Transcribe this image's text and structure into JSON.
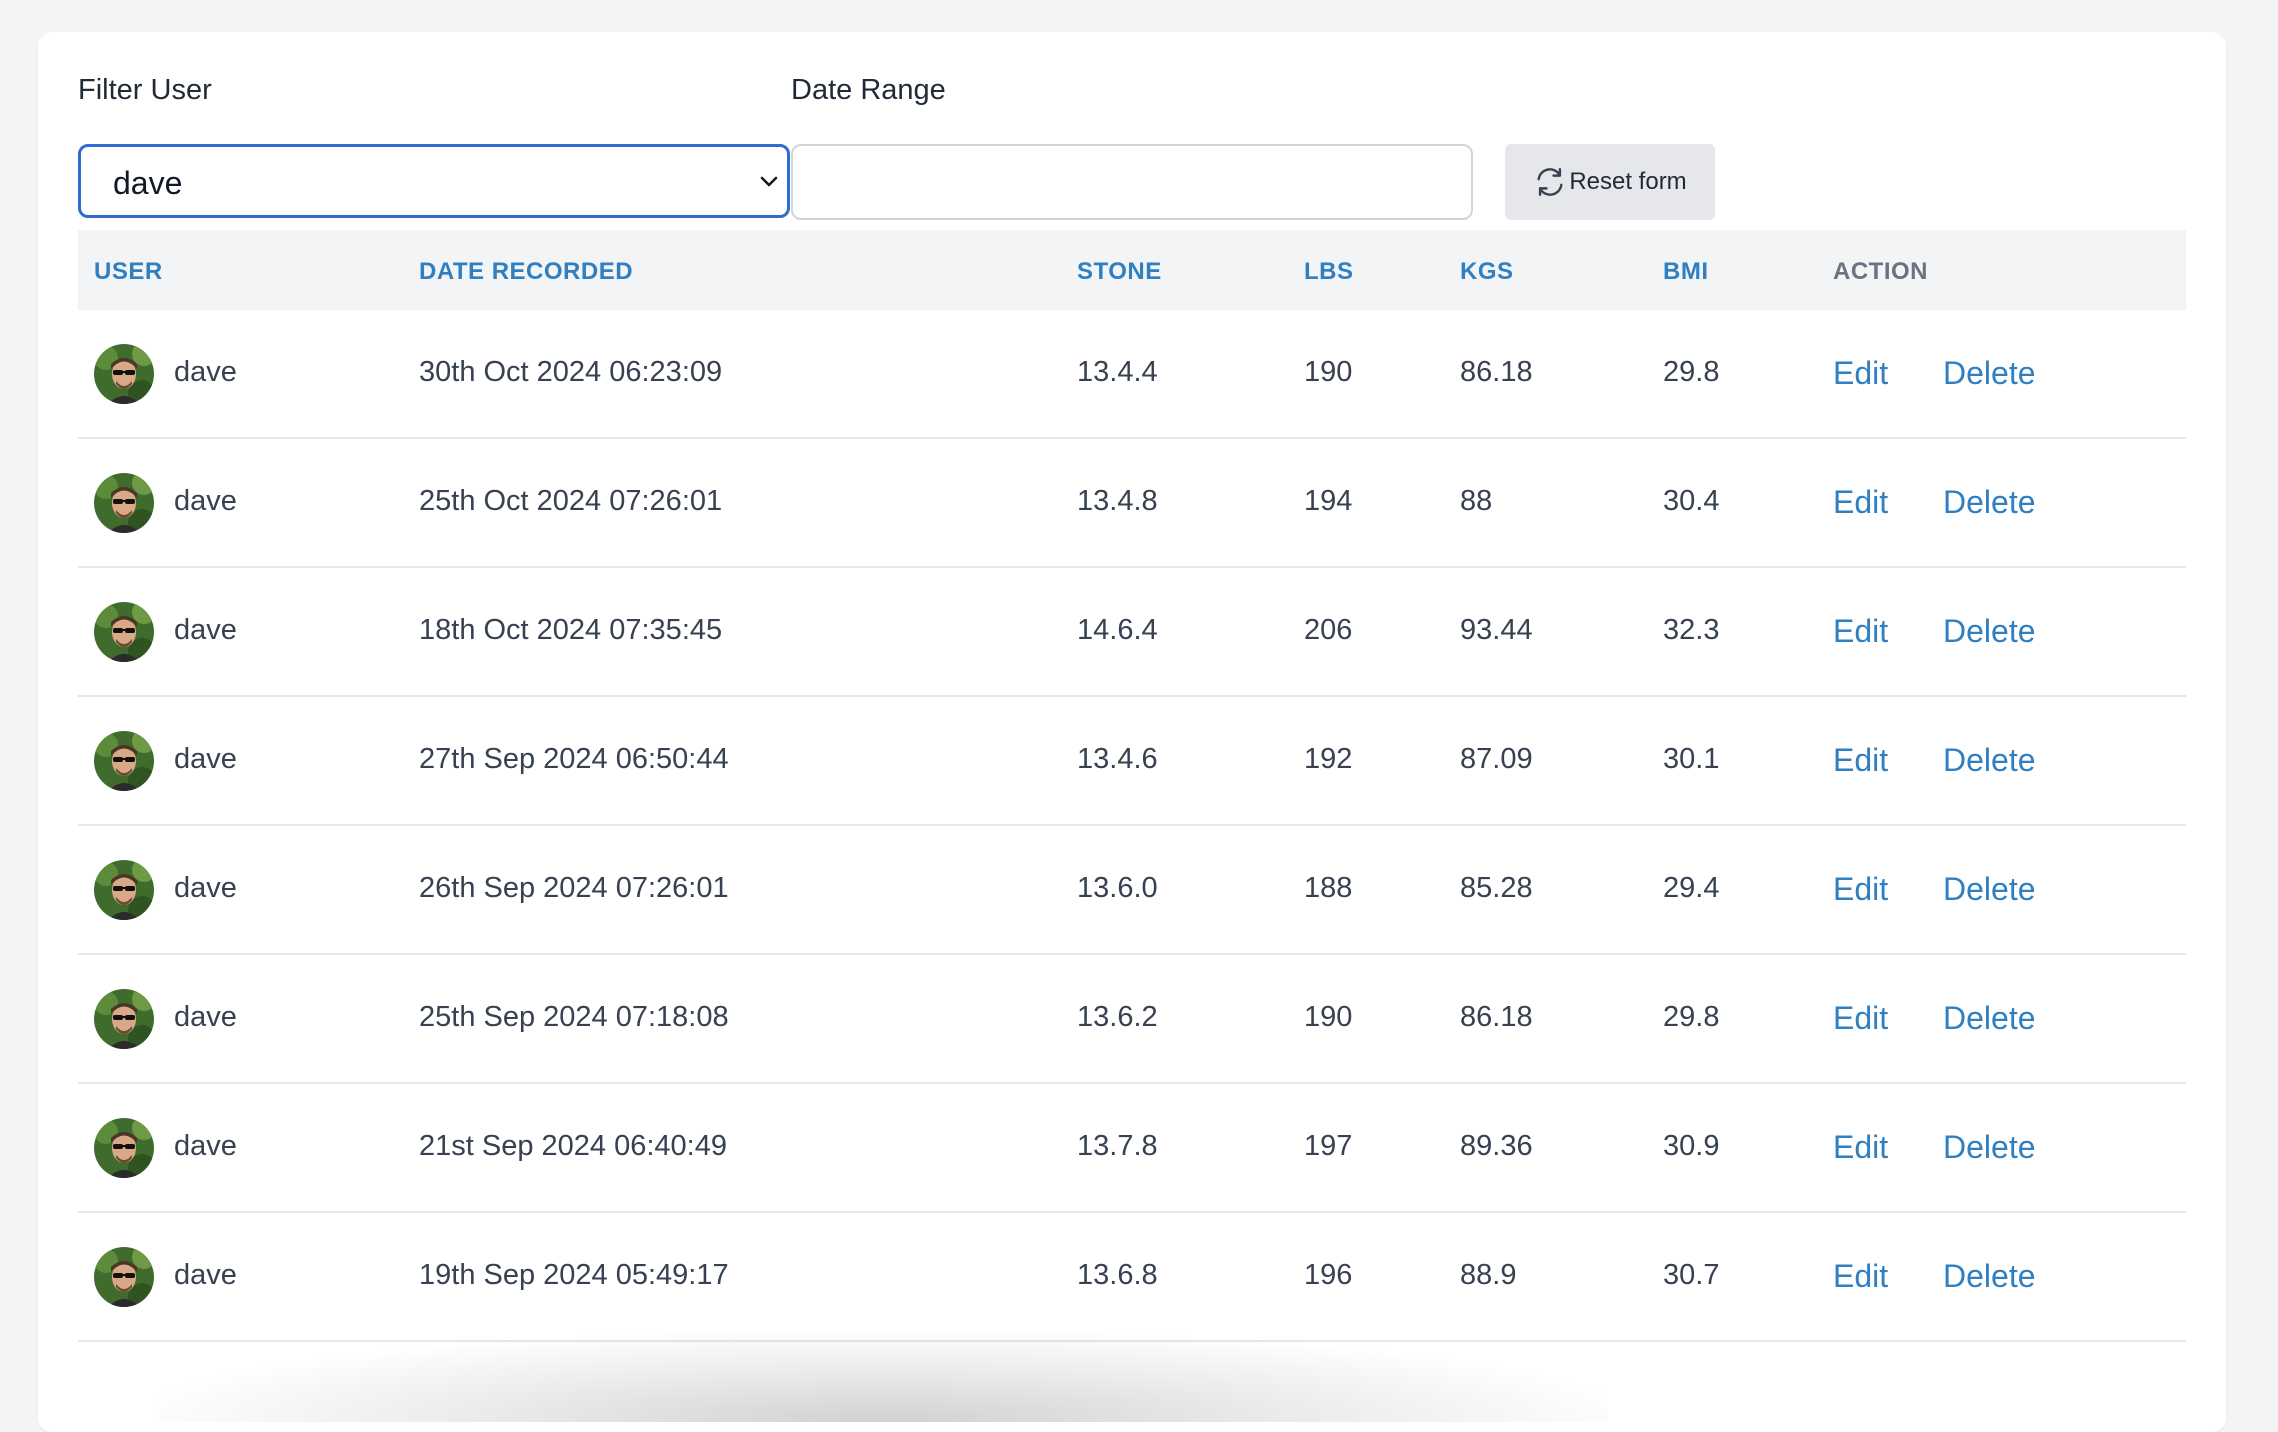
{
  "filters": {
    "user_label": "Filter User",
    "user_value": "dave",
    "date_label": "Date Range",
    "date_value": "",
    "reset_label": "Reset form"
  },
  "table": {
    "headers": {
      "user": "USER",
      "date": "DATE RECORDED",
      "stone": "STONE",
      "lbs": "LBS",
      "kgs": "KGS",
      "bmi": "BMI",
      "action": "ACTION"
    },
    "edit_label": "Edit",
    "delete_label": "Delete",
    "rows": [
      {
        "user": "dave",
        "date": "30th Oct 2024 06:23:09",
        "stone": "13.4.4",
        "lbs": "190",
        "kgs": "86.18",
        "bmi": "29.8"
      },
      {
        "user": "dave",
        "date": "25th Oct 2024 07:26:01",
        "stone": "13.4.8",
        "lbs": "194",
        "kgs": "88",
        "bmi": "30.4"
      },
      {
        "user": "dave",
        "date": "18th Oct 2024 07:35:45",
        "stone": "14.6.4",
        "lbs": "206",
        "kgs": "93.44",
        "bmi": "32.3"
      },
      {
        "user": "dave",
        "date": "27th Sep 2024 06:50:44",
        "stone": "13.4.6",
        "lbs": "192",
        "kgs": "87.09",
        "bmi": "30.1"
      },
      {
        "user": "dave",
        "date": "26th Sep 2024 07:26:01",
        "stone": "13.6.0",
        "lbs": "188",
        "kgs": "85.28",
        "bmi": "29.4"
      },
      {
        "user": "dave",
        "date": "25th Sep 2024 07:18:08",
        "stone": "13.6.2",
        "lbs": "190",
        "kgs": "86.18",
        "bmi": "29.8"
      },
      {
        "user": "dave",
        "date": "21st Sep 2024 06:40:49",
        "stone": "13.7.8",
        "lbs": "197",
        "kgs": "89.36",
        "bmi": "30.9"
      },
      {
        "user": "dave",
        "date": "19th Sep 2024 05:49:17",
        "stone": "13.6.8",
        "lbs": "196",
        "kgs": "88.9",
        "bmi": "30.7"
      }
    ]
  },
  "colors": {
    "accent": "#2f7fc1",
    "focus_border": "#2f6ccf",
    "header_bg": "#f3f4f6",
    "page_bg": "#f3f4f6"
  },
  "icons": {
    "chevron": "chevron-down-icon",
    "reset": "refresh-icon",
    "avatar": "avatar-photo"
  }
}
